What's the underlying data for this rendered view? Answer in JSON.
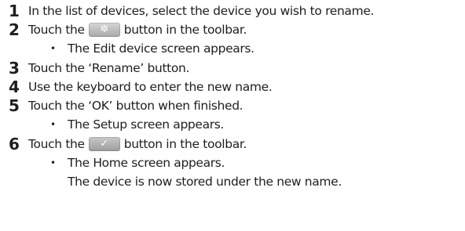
{
  "steps": [
    {
      "number": "1",
      "text": "In the list of devices, select the device you wish to rename."
    },
    {
      "number": "2",
      "text_before": "Touch the",
      "icon": "gear-icon",
      "text_after": "button in the toolbar.",
      "bullet": "•",
      "sub": "The Edit device screen appears."
    },
    {
      "number": "3",
      "text": "Touch the ‘Rename’ button."
    },
    {
      "number": "4",
      "text": "Use the keyboard to enter the new name."
    },
    {
      "number": "5",
      "text": "Touch the ‘OK’ button when finished.",
      "bullet": "•",
      "sub": "The Setup screen appears."
    },
    {
      "number": "6",
      "text_before": "Touch the",
      "icon": "check-icon",
      "text_after": "button in the toolbar.",
      "bullet": "•",
      "sub": "The Home screen appears.",
      "sub2": "The device is now stored under the new name."
    }
  ],
  "icons": {
    "gear_glyph": "✲",
    "check_glyph": "✓"
  }
}
